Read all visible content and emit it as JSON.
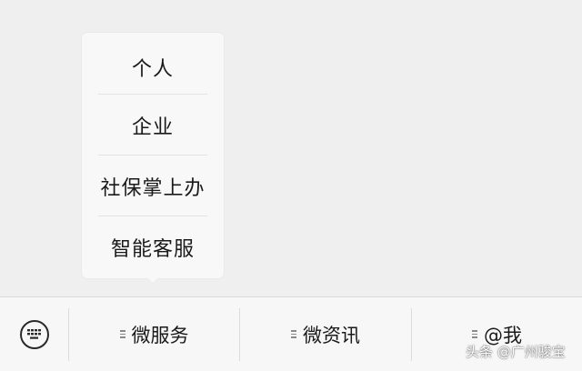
{
  "popup_menu": {
    "items": [
      {
        "label": "个人"
      },
      {
        "label": "企业"
      },
      {
        "label": "社保掌上办"
      },
      {
        "label": "智能客服"
      }
    ]
  },
  "bottom_bar": {
    "keyboard_icon": "keyboard-icon",
    "tabs": [
      {
        "label": "微服务",
        "icon": "menu-lines-icon"
      },
      {
        "label": "微资讯",
        "icon": "menu-lines-icon"
      },
      {
        "label": "@我",
        "icon": "menu-lines-icon"
      }
    ]
  },
  "watermark": {
    "text": "头条 @广州骏宝"
  },
  "colors": {
    "background": "#efeff0",
    "popup": "#f8f8f8",
    "bar": "#f7f7f7",
    "text": "#1a1a1a"
  }
}
